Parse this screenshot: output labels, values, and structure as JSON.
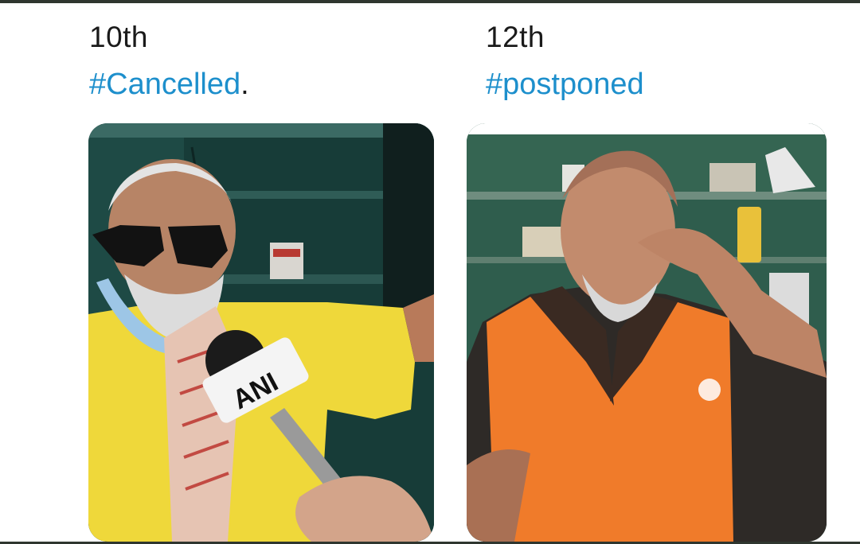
{
  "left": {
    "day": "10th",
    "hashtag": "#Cancelled",
    "punct": ".",
    "photo": {
      "mic_logo": "ANI"
    }
  },
  "right": {
    "day": "12th",
    "hashtag": "#postponed"
  },
  "colors": {
    "hashtag": "#1d8fcc",
    "frame": "#2f362f"
  }
}
